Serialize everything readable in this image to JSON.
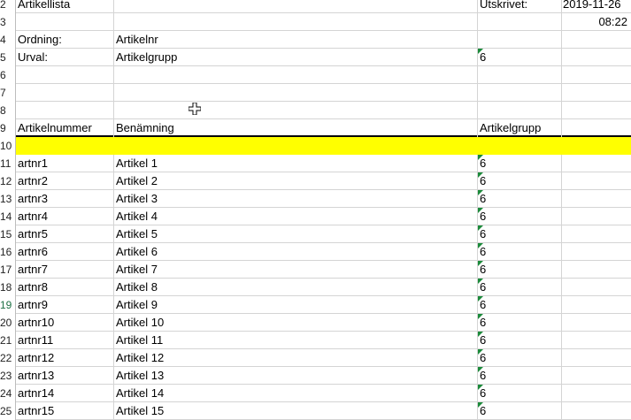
{
  "rows": [
    {
      "n": "2",
      "a": "Artikellista",
      "b": "",
      "c": "Utskrivet:",
      "d": "2019-11-26"
    },
    {
      "n": "3",
      "a": "",
      "b": "",
      "c": "",
      "d": "08:22"
    },
    {
      "n": "4",
      "a": "Ordning:",
      "b": "Artikelnr",
      "c": "",
      "d": ""
    },
    {
      "n": "5",
      "a": "Urval:",
      "b": "Artikelgrupp",
      "c": "6",
      "d": ""
    },
    {
      "n": "6",
      "a": "",
      "b": "",
      "c": "",
      "d": ""
    },
    {
      "n": "7",
      "a": "",
      "b": "",
      "c": "",
      "d": ""
    },
    {
      "n": "8",
      "a": "",
      "b": "",
      "c": "",
      "d": ""
    },
    {
      "n": "9",
      "a": "Artikelnummer",
      "b": "Benämning",
      "c": "Artikelgrupp",
      "d": ""
    },
    {
      "n": "10",
      "a": "",
      "b": "",
      "c": "",
      "d": ""
    },
    {
      "n": "11",
      "a": "artnr1",
      "b": "Artikel 1",
      "c": "6",
      "d": ""
    },
    {
      "n": "12",
      "a": "artnr2",
      "b": "Artikel 2",
      "c": "6",
      "d": ""
    },
    {
      "n": "13",
      "a": "artnr3",
      "b": "Artikel 3",
      "c": "6",
      "d": ""
    },
    {
      "n": "14",
      "a": "artnr4",
      "b": "Artikel 4",
      "c": "6",
      "d": ""
    },
    {
      "n": "15",
      "a": "artnr5",
      "b": "Artikel 5",
      "c": "6",
      "d": ""
    },
    {
      "n": "16",
      "a": "artnr6",
      "b": "Artikel 6",
      "c": "6",
      "d": ""
    },
    {
      "n": "17",
      "a": "artnr7",
      "b": "Artikel 7",
      "c": "6",
      "d": ""
    },
    {
      "n": "18",
      "a": "artnr8",
      "b": "Artikel 8",
      "c": "6",
      "d": ""
    },
    {
      "n": "19",
      "a": "artnr9",
      "b": "Artikel 9",
      "c": "6",
      "d": ""
    },
    {
      "n": "20",
      "a": "artnr10",
      "b": "Artikel 10",
      "c": "6",
      "d": ""
    },
    {
      "n": "21",
      "a": "artnr11",
      "b": "Artikel 11",
      "c": "6",
      "d": ""
    },
    {
      "n": "22",
      "a": "artnr12",
      "b": "Artikel 12",
      "c": "6",
      "d": ""
    },
    {
      "n": "23",
      "a": "artnr13",
      "b": "Artikel 13",
      "c": "6",
      "d": ""
    },
    {
      "n": "24",
      "a": "artnr14",
      "b": "Artikel 14",
      "c": "6",
      "d": ""
    },
    {
      "n": "25",
      "a": "artnr15",
      "b": "Artikel 15",
      "c": "6",
      "d": ""
    }
  ],
  "highlight_color": "#ffff00",
  "number_as_text_flag_color": "#1b8a3a",
  "cursor_icon": "plus-cursor-icon"
}
